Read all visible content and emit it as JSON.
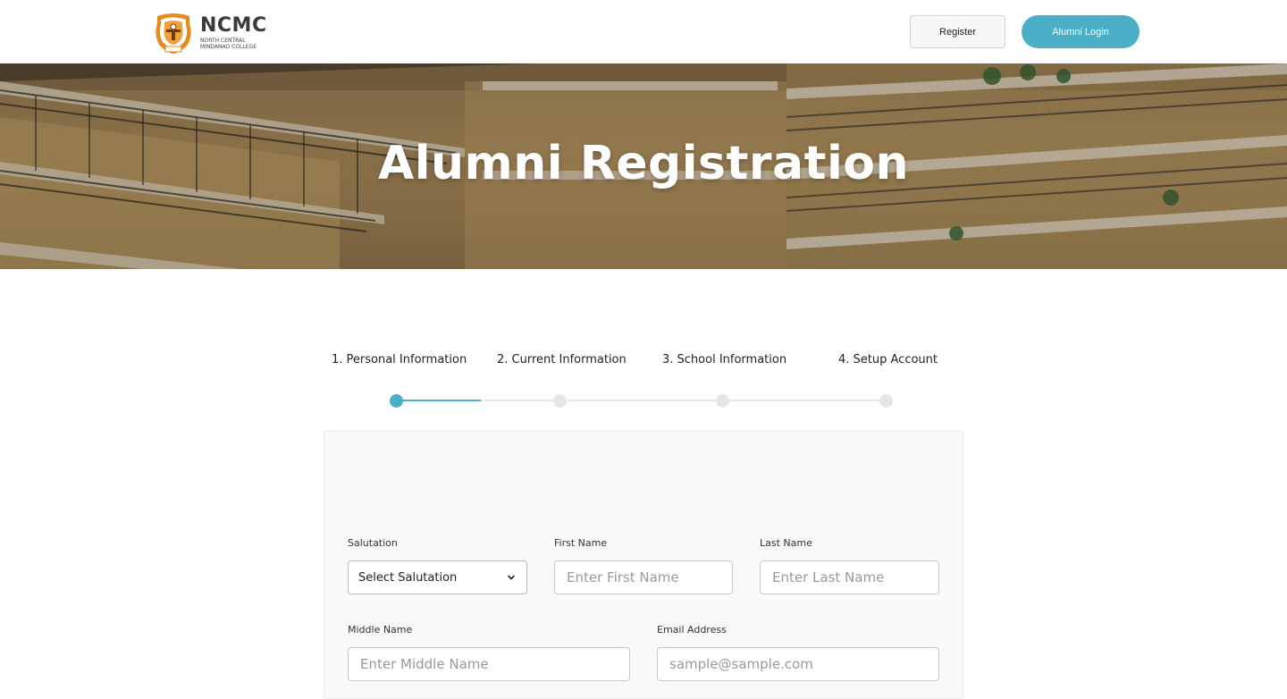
{
  "header": {
    "logo": {
      "abbr": "NCMC",
      "full_name": "NORTH CENTRAL\nMINDANAO COLLEGE"
    },
    "register_label": "Register",
    "login_label": "Alumni Login"
  },
  "hero": {
    "title": "Alumni Registration"
  },
  "steps": [
    {
      "label": "1. Personal Information",
      "active": true
    },
    {
      "label": "2. Current Information",
      "active": false
    },
    {
      "label": "3. School Information",
      "active": false
    },
    {
      "label": "4. Setup Account",
      "active": false
    }
  ],
  "form": {
    "salutation": {
      "label": "Salutation",
      "value": "Select Salutation"
    },
    "first_name": {
      "label": "First Name",
      "placeholder": "Enter First Name"
    },
    "last_name": {
      "label": "Last Name",
      "placeholder": "Enter Last Name"
    },
    "middle_name": {
      "label": "Middle Name",
      "placeholder": "Enter Middle Name"
    },
    "email": {
      "label": "Email Address",
      "placeholder": "sample@sample.com"
    }
  },
  "colors": {
    "accent": "#4bafc8",
    "logo_orange": "#e88a1c",
    "text": "#222222"
  },
  "icons": {
    "logo": "college-seal-icon",
    "select_arrow": "chevron-down-icon"
  }
}
